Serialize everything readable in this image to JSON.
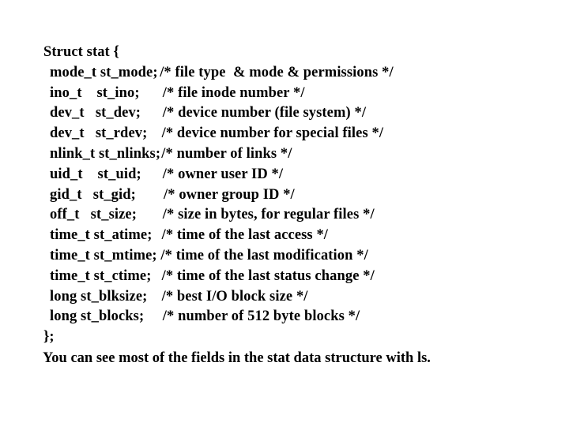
{
  "slide": {
    "background_color": "#ffffff",
    "text_color": "#000000",
    "header": "Struct stat {",
    "closing": "};",
    "trailing_note": "You can see most of the fields in the stat data structure with ls.",
    "fields": [
      {
        "type": "mode_t",
        "name": "st_mode;",
        "declaration": "mode_t st_mode;",
        "comment": "/* file type  & mode & permissions */",
        "comment_indent": 1
      },
      {
        "type": "ino_t",
        "name": "st_ino;",
        "declaration": "ino_t    st_ino;",
        "comment": "/* file inode number */",
        "comment_indent": 4
      },
      {
        "type": "dev_t",
        "name": "st_dev;",
        "declaration": "dev_t   st_dev;",
        "comment": "/* device number (file system) */",
        "comment_indent": 4
      },
      {
        "type": "dev_t",
        "name": "st_rdev;",
        "declaration": "dev_t   st_rdev;",
        "comment": "/* device number for special files */",
        "comment_indent": 3
      },
      {
        "type": "nlink_t",
        "name": "st_nlinks;",
        "declaration": "nlink_t st_nlinks;",
        "comment": "/* number of links */",
        "comment_indent": 1
      },
      {
        "type": "uid_t",
        "name": "st_uid;",
        "declaration": "uid_t    st_uid;",
        "comment": "/* owner user ID */",
        "comment_indent": 4
      },
      {
        "type": "gid_t",
        "name": "st_gid;",
        "declaration": "gid_t   st_gid;",
        "comment": "/* owner group ID */",
        "comment_indent": 5
      },
      {
        "type": "off_t",
        "name": "st_size;",
        "declaration": "off_t   st_size;",
        "comment": "/* size in bytes, for regular files */",
        "comment_indent": 4
      },
      {
        "type": "time_t",
        "name": "st_atime;",
        "declaration": "time_t st_atime;",
        "comment": "/* time of the last access */",
        "comment_indent": 3
      },
      {
        "type": "time_t",
        "name": "st_mtime;",
        "declaration": "time_t st_mtime;",
        "comment": "/* time of the last modification */",
        "comment_indent": 2
      },
      {
        "type": "time_t",
        "name": "st_ctime;",
        "declaration": "time_t st_ctime;",
        "comment": "/* time of the last status change */",
        "comment_indent": 3
      },
      {
        "type": "long",
        "name": "st_blksize;",
        "declaration": "long st_blksize;",
        "comment": "/* best I/O block size */",
        "comment_indent": 3
      },
      {
        "type": "long",
        "name": "st_blocks;",
        "declaration": "long st_blocks;",
        "comment": "/* number of 512 byte blocks */",
        "comment_indent": 4
      }
    ]
  }
}
